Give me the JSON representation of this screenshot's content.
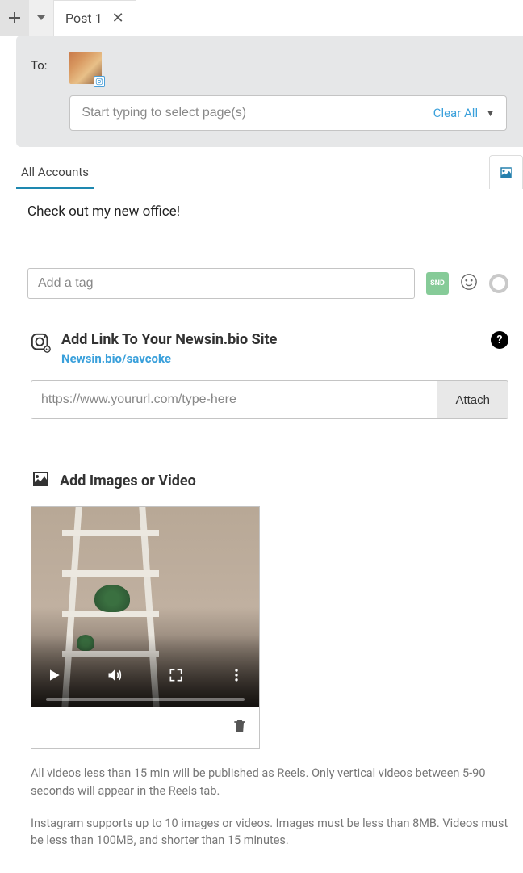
{
  "tabs": {
    "items": [
      {
        "label": "Post 1"
      }
    ]
  },
  "to": {
    "label": "To:",
    "input_placeholder": "Start typing to select page(s)",
    "clear_label": "Clear All"
  },
  "accounts": {
    "tab_label": "All Accounts"
  },
  "message": {
    "text": "Check out my new office!",
    "tag_placeholder": "Add a tag",
    "snd_badge": "SND"
  },
  "link": {
    "title": "Add Link To Your Newsin.bio Site",
    "subtitle": "Newsin.bio/savcoke",
    "url_placeholder": "https://www.yoururl.com/type-here",
    "attach_label": "Attach",
    "help_label": "?"
  },
  "media": {
    "title": "Add Images or Video",
    "info1": "All videos less than 15 min will be published as Reels. Only vertical videos between 5-90 seconds will appear in the Reels tab.",
    "info2": "Instagram supports up to 10 images or videos. Images must be less than 8MB. Videos must be less than 100MB, and shorter than 15 minutes."
  }
}
